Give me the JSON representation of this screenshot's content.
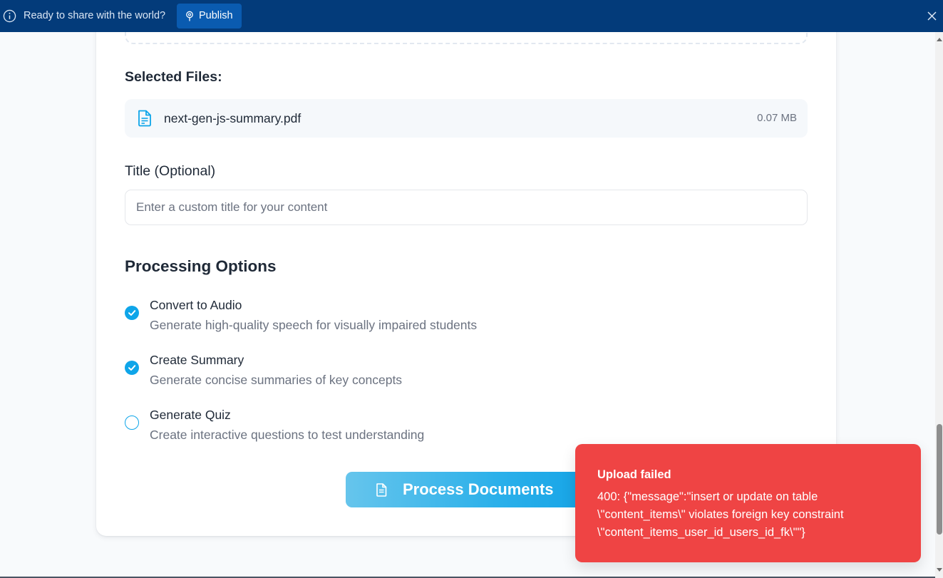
{
  "banner": {
    "message": "Ready to share with the world?",
    "publish_label": "Publish",
    "bg_color": "#033b7a"
  },
  "upload_form": {
    "selected_files_heading": "Selected Files:",
    "files": [
      {
        "name": "next-gen-js-summary.pdf",
        "size": "0.07 MB",
        "icon": "document-icon"
      }
    ],
    "title_label": "Title (Optional)",
    "title_placeholder": "Enter a custom title for your content",
    "title_value": "",
    "processing_heading": "Processing Options",
    "options": [
      {
        "label": "Convert to Audio",
        "description": "Generate high-quality speech for visually impaired students",
        "checked": true
      },
      {
        "label": "Create Summary",
        "description": "Generate concise summaries of key concepts",
        "checked": true
      },
      {
        "label": "Generate Quiz",
        "description": "Create interactive questions to test understanding",
        "checked": false
      }
    ],
    "process_button_label": "Process Documents",
    "accent_color": "#0ea5e9"
  },
  "toast": {
    "title": "Upload failed",
    "lines": [
      "400: {\"message\":\"insert or update on table",
      "\\\"content_items\\\" violates foreign key constraint",
      "\\\"content_items_user_id_users_id_fk\\\"\"}"
    ],
    "bg_color": "#ef4444"
  }
}
